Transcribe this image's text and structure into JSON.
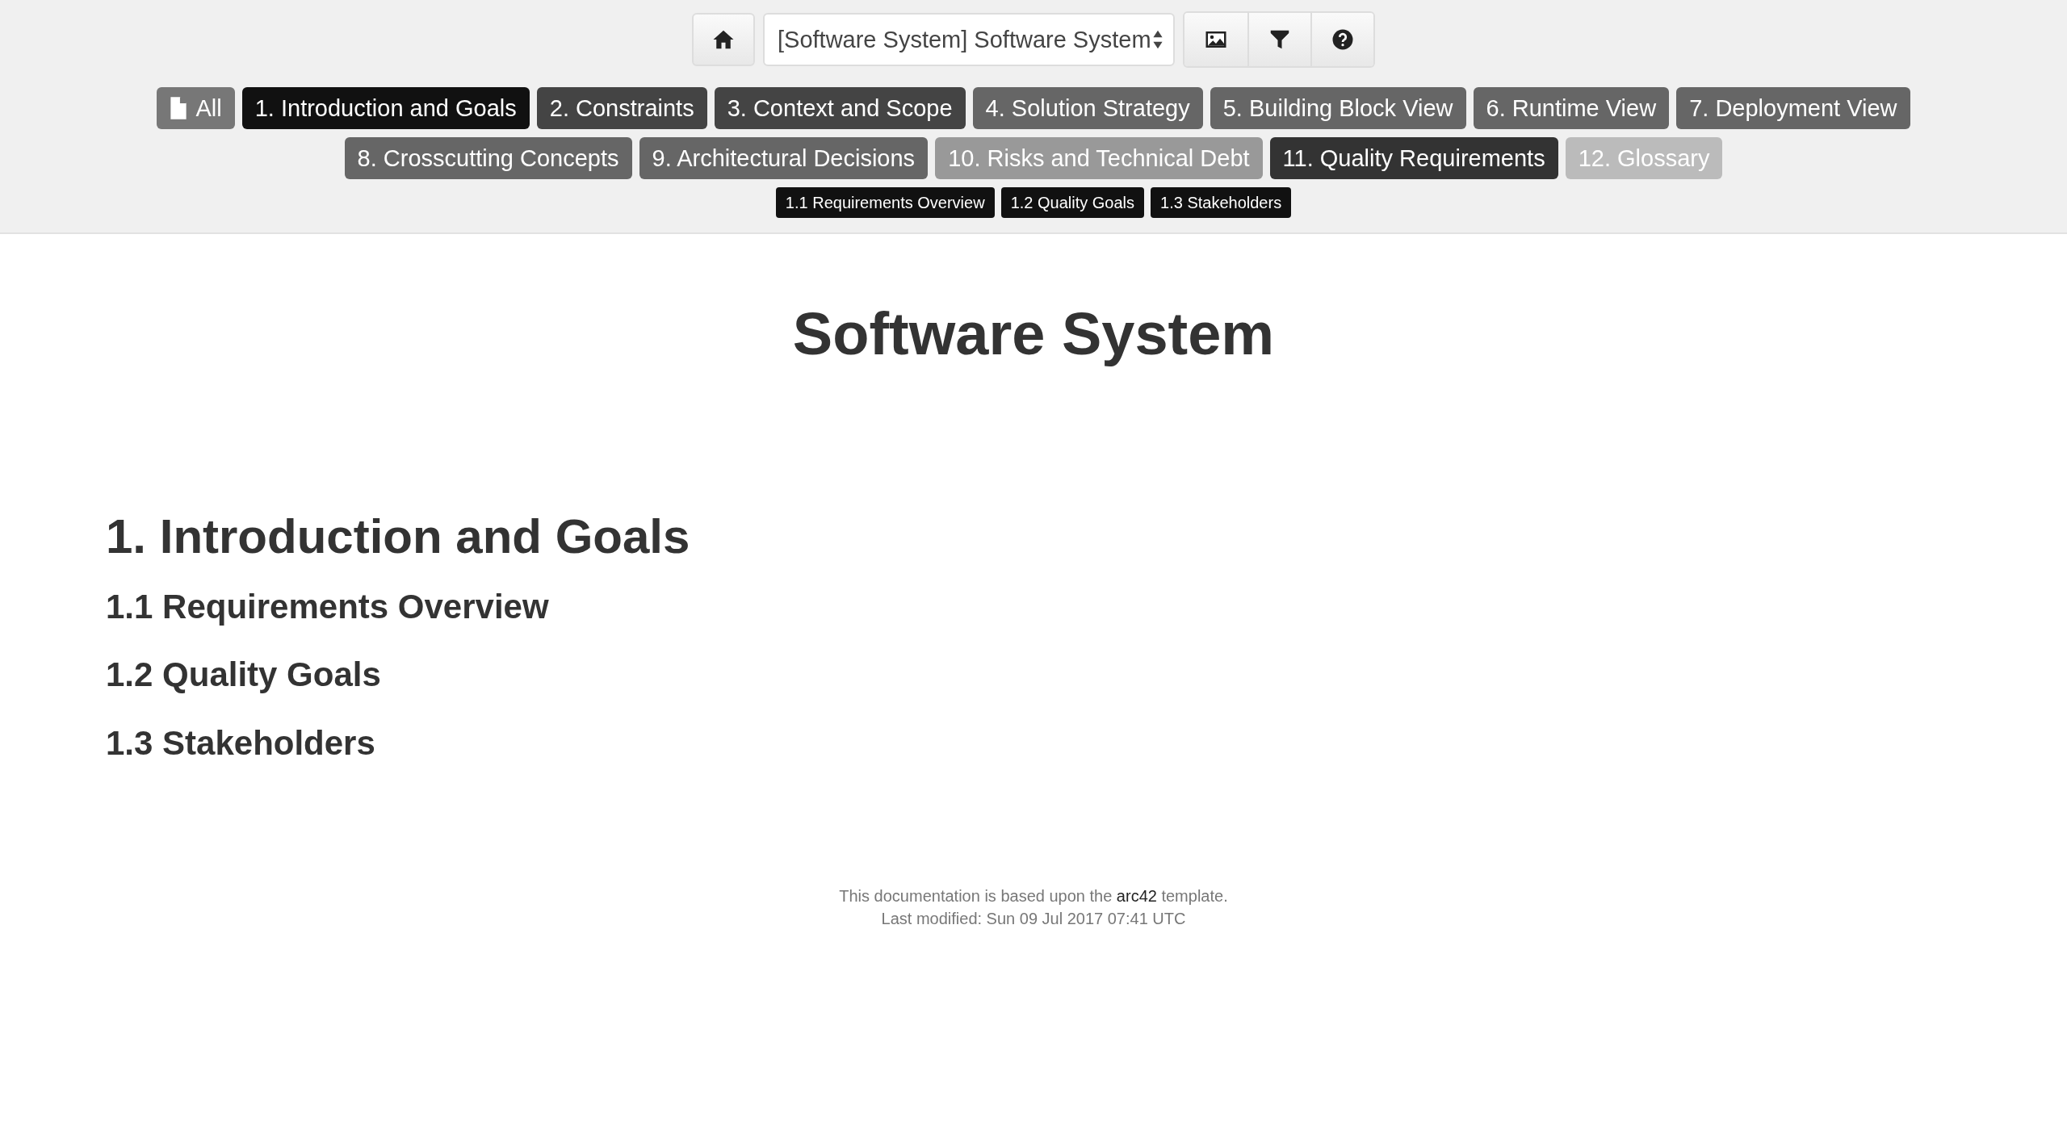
{
  "toolbar": {
    "view_selector": {
      "value": "[Software System] Software System"
    },
    "buttons": [
      {
        "kind": "home"
      },
      {
        "kind": "image"
      },
      {
        "kind": "filter"
      },
      {
        "kind": "help"
      }
    ]
  },
  "section_tabs": [
    {
      "label": "All",
      "kind": "all",
      "color": "#777777"
    },
    {
      "label": "1. Introduction and Goals",
      "color": "#111111"
    },
    {
      "label": "2. Constraints",
      "color": "#444444"
    },
    {
      "label": "3. Context and Scope",
      "color": "#444444"
    },
    {
      "label": "4. Solution Strategy",
      "color": "#666666"
    },
    {
      "label": "5. Building Block View",
      "color": "#666666"
    },
    {
      "label": "6. Runtime View",
      "color": "#666666"
    },
    {
      "label": "7. Deployment View",
      "color": "#666666"
    },
    {
      "label": "8. Crosscutting Concepts",
      "color": "#666666"
    },
    {
      "label": "9. Architectural Decisions",
      "color": "#666666"
    },
    {
      "label": "10. Risks and Technical Debt",
      "color": "#999999"
    },
    {
      "label": "11. Quality Requirements",
      "color": "#333333"
    },
    {
      "label": "12. Glossary",
      "color": "#bbbbbb"
    }
  ],
  "subsection_tabs": [
    "1.1 Requirements Overview",
    "1.2 Quality Goals",
    "1.3 Stakeholders"
  ],
  "document": {
    "title": "Software System",
    "section_heading": "1. Introduction and Goals",
    "subsection_headings": [
      "1.1 Requirements Overview",
      "1.2 Quality Goals",
      "1.3 Stakeholders"
    ]
  },
  "footer": {
    "text_before_link": "This documentation is based upon the ",
    "link": "arc42",
    "text_after_link": " template.",
    "last_modified": "Last modified: Sun 09 Jul 2017 07:41 UTC"
  }
}
